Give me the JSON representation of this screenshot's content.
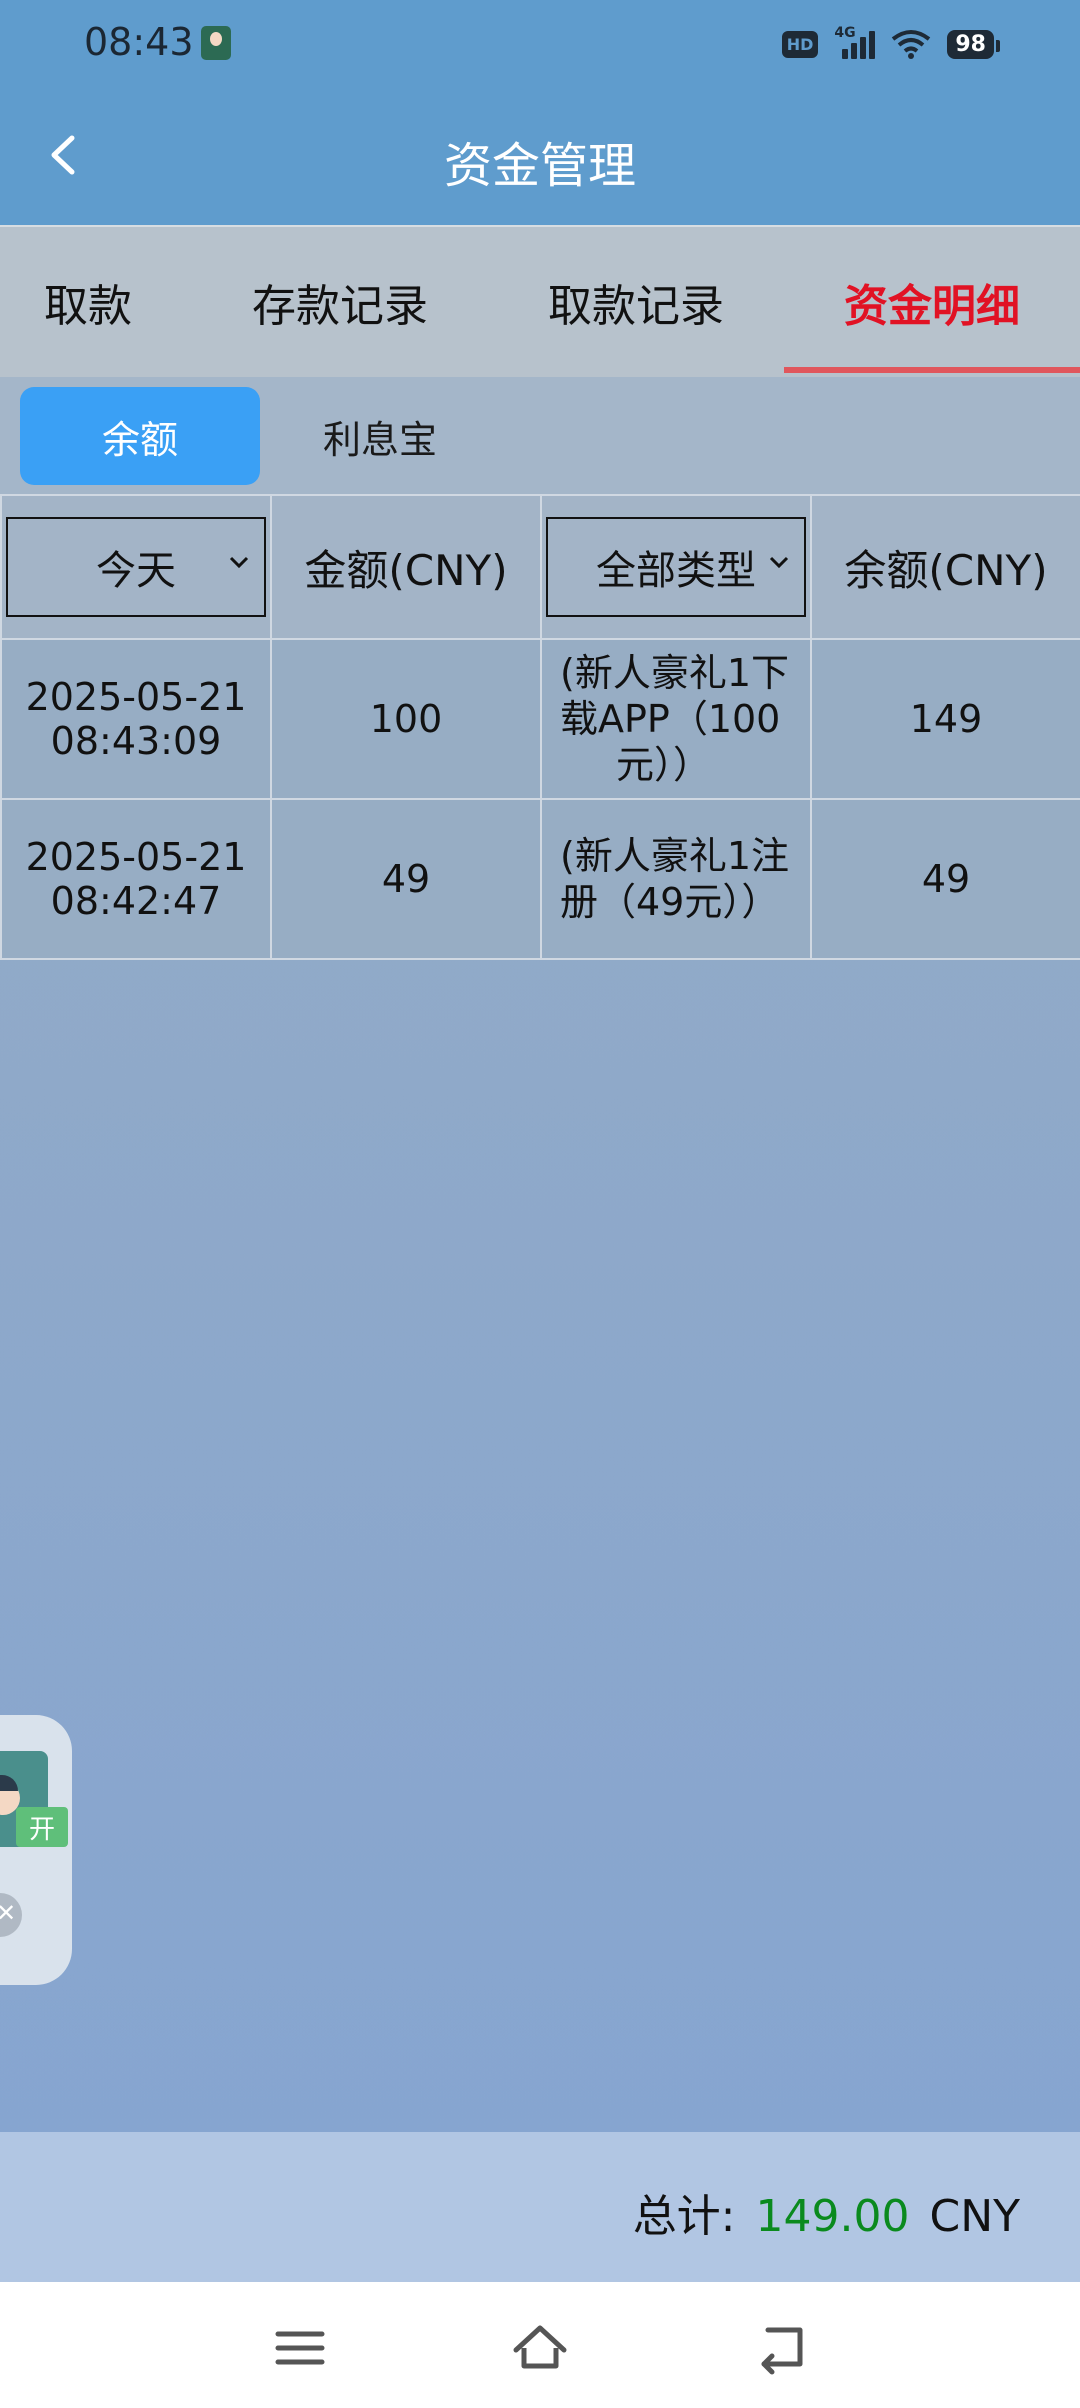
{
  "status_bar": {
    "time": "08:43",
    "hd_label": "HD",
    "network_label": "4G",
    "battery": "98"
  },
  "header": {
    "title": "资金管理"
  },
  "main_tabs": [
    {
      "label": "取款",
      "active": false
    },
    {
      "label": "存款记录",
      "active": false
    },
    {
      "label": "取款记录",
      "active": false
    },
    {
      "label": "资金明细",
      "active": true
    }
  ],
  "sub_tabs": [
    {
      "label": "余额",
      "active": true
    },
    {
      "label": "利息宝",
      "active": false
    }
  ],
  "table": {
    "date_filter": "今天",
    "amount_header": "金额(CNY)",
    "type_filter": "全部类型",
    "balance_header": "余额(CNY)",
    "rows": [
      {
        "date": "2025-05-21",
        "time": "08:43:09",
        "amount": "100",
        "type_line1": "(新人豪礼1下",
        "type_line2": "载APP（100",
        "type_line3": "元））",
        "balance": "149"
      },
      {
        "date": "2025-05-21",
        "time": "08:42:47",
        "amount": "49",
        "type_line1": "(新人豪礼1注",
        "type_line2": "册（49元））",
        "type_line3": "",
        "balance": "49"
      }
    ]
  },
  "float_widget": {
    "badge": "开"
  },
  "summary": {
    "label": "总计:",
    "amount": "149.00",
    "currency": "CNY"
  },
  "colors": {
    "header_bg": "#5f9ccd",
    "active_tab": "#e11224",
    "sub_tab_active_bg": "#3aa0f5",
    "total_amount": "#0a8a1e"
  }
}
